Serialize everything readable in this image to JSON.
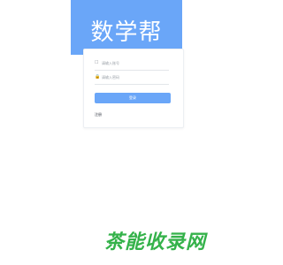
{
  "app": {
    "title": "数学帮",
    "brand_color": "#6aa6f8"
  },
  "login_form": {
    "phone_icon": "user-icon",
    "phone_placeholder": "请输入账号",
    "password_icon": "lock-icon",
    "password_placeholder": "请输入密码",
    "login_label": "登录",
    "register_label": "注册"
  },
  "watermark": {
    "text": "茶能收录网",
    "color": "#34b24a"
  }
}
